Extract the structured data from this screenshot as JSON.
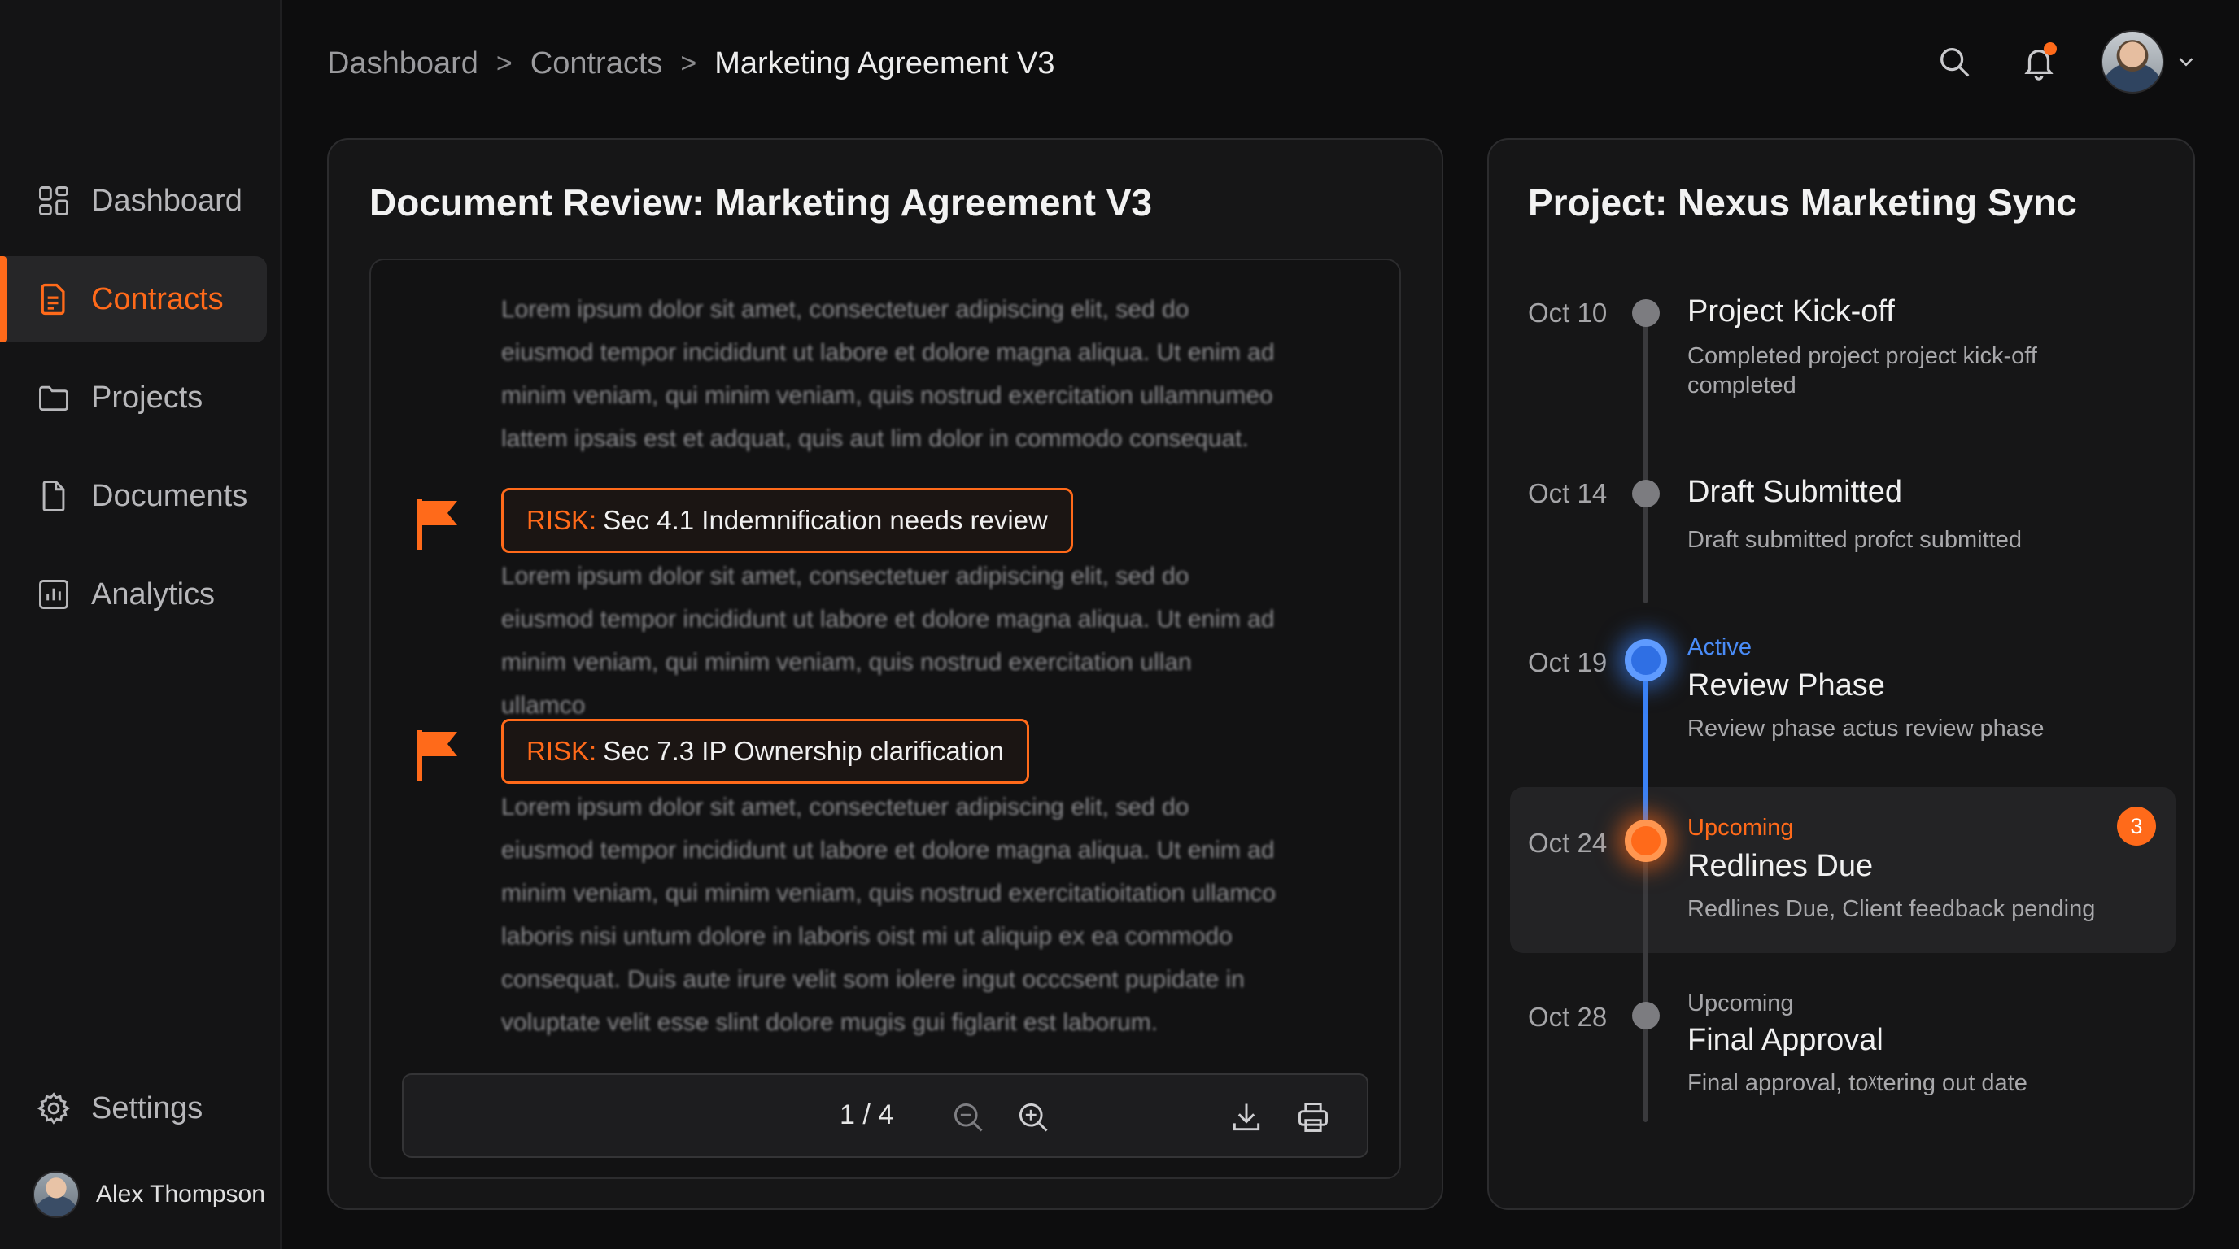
{
  "sidebar": {
    "items": [
      {
        "label": "Dashboard",
        "icon": "dashboard-grid-icon"
      },
      {
        "label": "Contracts",
        "icon": "contract-document-icon",
        "active": true
      },
      {
        "label": "Projects",
        "icon": "folder-icon"
      },
      {
        "label": "Documents",
        "icon": "file-icon"
      },
      {
        "label": "Analytics",
        "icon": "bar-chart-icon"
      }
    ],
    "settings_label": "Settings",
    "user_name": "Alex Thompson"
  },
  "breadcrumb": {
    "items": [
      "Dashboard",
      "Contracts",
      "Marketing Agreement V3"
    ],
    "separator": ">"
  },
  "header": {
    "icons": [
      "search-icon",
      "bell-icon",
      "chevron-down-icon"
    ],
    "notification_dot": true
  },
  "document": {
    "title": "Document Review: Marketing Agreement V3",
    "paragraphs": [
      "Lorem ipsum dolor sit amet, consectetuer adipiscing elit, sed do eiusmod tempor incididunt ut labore et dolore magna aliqua. Ut enim ad minim veniam, qui minim veniam, quis nostrud exercitation ullamnumeo lattem ipsais est et adquat, quis aut lim dolor in commodo consequat.",
      "Lorem ipsum dolor sit amet, consectetuer adipiscing elit, sed do eiusmod tempor incididunt ut labore et dolore magna aliqua. Ut enim ad minim veniam, qui minim veniam, quis nostrud exercitation ullan ullamco",
      "Lorem ipsum dolor sit amet, consectetuer adipiscing elit, sed do eiusmod tempor incididunt ut labore et dolore magna aliqua. Ut enim ad minim veniam, qui minim veniam, quis nostrud exercitatioitation ullamco laboris nisi untum dolore in laboris oist mi ut aliquip ex ea commodo consequat. Duis aute irure velit som iolere ingut occcsent pupidate in voluptate velit esse slint dolore mugis gui figlarit est laborum."
    ],
    "risks": [
      {
        "prefix": "RISK:",
        "text": "Sec 4.1 Indemnification needs review"
      },
      {
        "prefix": "RISK:",
        "text": "Sec 7.3 IP Ownership clarification"
      }
    ],
    "toolbar": {
      "page_indicator": "1 / 4",
      "icons": [
        "zoom-out-icon",
        "zoom-in-icon",
        "download-icon",
        "print-icon"
      ]
    }
  },
  "timeline": {
    "title": "Project: Nexus Marketing Sync",
    "events": [
      {
        "date": "Oct 10",
        "status": "",
        "title": "Project Kick-off",
        "desc": "Completed project project kick-off completed"
      },
      {
        "date": "Oct 14",
        "status": "",
        "title": "Draft Submitted",
        "desc": "Draft submitted profct submitted"
      },
      {
        "date": "Oct 19",
        "status": "Active",
        "title": "Review Phase",
        "desc": "Review phase actus review phase"
      },
      {
        "date": "Oct 24",
        "status": "Upcoming",
        "title": "Redlines Due",
        "desc": "Redlines Due, Client feedback pending",
        "badge": "3"
      },
      {
        "date": "Oct 28",
        "status": "Upcoming",
        "title": "Final Approval",
        "desc": "Final approval, toᵡtering out date"
      }
    ]
  },
  "colors": {
    "accent_orange": "#ff6a1a",
    "accent_blue": "#3b82f6",
    "background": "#0d0d0e",
    "card": "#161617"
  }
}
